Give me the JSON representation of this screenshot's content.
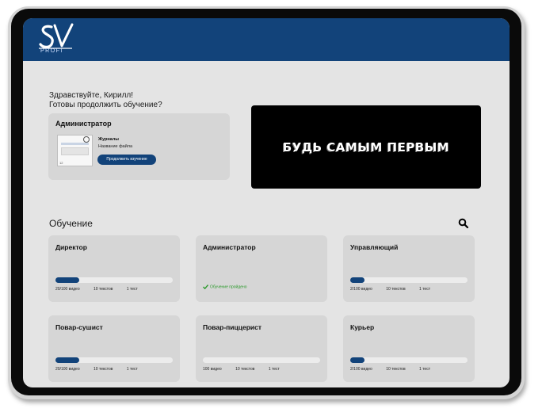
{
  "header": {
    "logo_letters": "SV",
    "logo_subtext": "PROFI"
  },
  "greeting": {
    "line1": "Здравствуйте, Кирилл!",
    "line2": "Готовы продолжить обучение?"
  },
  "last_course": {
    "title": "Администратор",
    "section": "Журналы",
    "file": "Название файла",
    "button": "Продолжить изучение",
    "thumb_number": "12"
  },
  "banner": {
    "text": "БУДЬ САМЫМ ПЕРВЫМ"
  },
  "learning": {
    "title": "Обучение",
    "courses": [
      {
        "name": "Директор",
        "videos": "20/100 видео",
        "texts": "10 текстов",
        "tests": "1 тест",
        "progress": 0.2
      },
      {
        "name": "Администратор",
        "completed_text": "Обучение пройдено"
      },
      {
        "name": "Управляющий",
        "videos": "2/100 видео",
        "texts": "10 текстов",
        "tests": "1 тест",
        "progress": 0.12
      },
      {
        "name": "Повар-сушист",
        "videos": "20/100 видео",
        "texts": "10 текстов",
        "tests": "1 тест",
        "progress": 0.2
      },
      {
        "name": "Повар-пиццерист",
        "videos": "100 видео",
        "texts": "10 текстов",
        "tests": "1 тест",
        "progress": 0
      },
      {
        "name": "Курьер",
        "videos": "2/100 видео",
        "texts": "10 текстов",
        "tests": "1 тест",
        "progress": 0.12
      }
    ]
  },
  "colors": {
    "brand": "#12437a",
    "success": "#2e9b2e"
  },
  "icons": {
    "search": "search-icon",
    "check": "check-icon"
  }
}
